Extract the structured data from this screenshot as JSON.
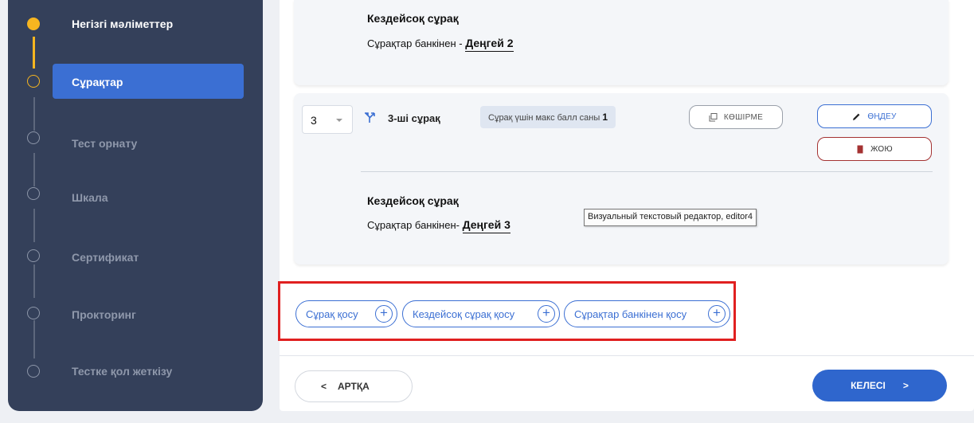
{
  "sidebar": {
    "steps": [
      {
        "label": "Негізгі мәліметтер",
        "state": "done"
      },
      {
        "label": "Сұрақтар",
        "state": "current"
      },
      {
        "label": "Тест орнату",
        "state": "pending"
      },
      {
        "label": "Шкала",
        "state": "pending"
      },
      {
        "label": "Сертификат",
        "state": "pending"
      },
      {
        "label": "Прокторинг",
        "state": "pending"
      },
      {
        "label": "Тестке қол жеткізу",
        "state": "pending"
      }
    ]
  },
  "questions": {
    "prev": {
      "title": "Кездейсоқ сұрақ",
      "bank_prefix": "Сұрақтар банкінен - ",
      "level": "Деңгей 2"
    },
    "current": {
      "number_value": "3",
      "label": "3-ші сұрақ",
      "max_label": "Сұрақ үшін макс балл саны",
      "max_value": "1",
      "copy_label": "КӨШІРМЕ",
      "edit_label": "ӨҢДЕУ",
      "delete_label": "ЖОЮ",
      "title": "Кездейсоқ сұрақ",
      "bank_prefix": "Сұрақтар банкінен- ",
      "level": "Деңгей 3"
    }
  },
  "tooltip": "Визуальный текстовый редактор, editor4",
  "add_buttons": {
    "add_question": "Сұрақ қосу",
    "add_random": "Кездейсоқ сұрақ қосу",
    "add_from_bank": "Сұрақтар банкінен қосу",
    "plus": "+"
  },
  "nav": {
    "back": "АРТҚА",
    "back_chevron": "<",
    "next": "КЕЛЕСІ",
    "next_chevron": ">"
  },
  "colors": {
    "sidebar_bg": "#34405a",
    "accent": "#3b6fd3",
    "step_done": "#f6b520",
    "delete_border": "#a43232",
    "highlight": "#e02020"
  }
}
